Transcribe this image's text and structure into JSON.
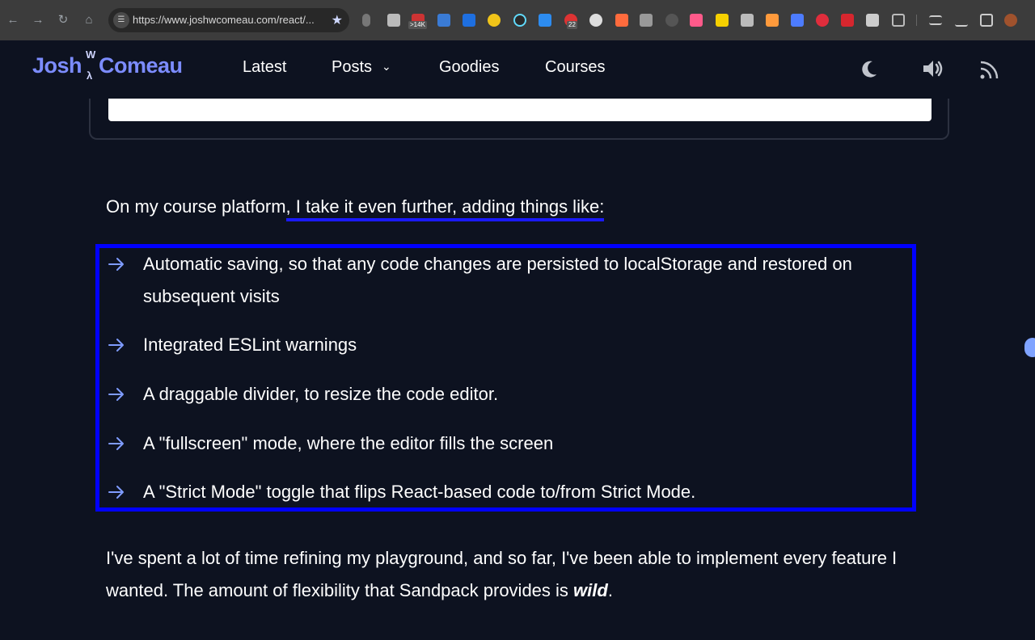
{
  "browser": {
    "url": "https://www.joshwcomeau.com/react/...",
    "ext_badges": [
      ">14K",
      "22"
    ]
  },
  "site": {
    "logo": {
      "first": "Josh",
      "middle_w": "W",
      "last": "Comeau"
    },
    "nav": [
      {
        "label": "Latest"
      },
      {
        "label": "Posts"
      },
      {
        "label": "Goodies"
      },
      {
        "label": "Courses"
      }
    ],
    "icons": [
      "moon-icon",
      "sound-icon",
      "rss-icon"
    ]
  },
  "article": {
    "intro_before": "On my course platform",
    "intro_highlight": ", I take it even further, adding things like:",
    "list": [
      "Automatic saving, so that any code changes are persisted to localStorage and restored on subsequent visits",
      "Integrated ESLint warnings",
      "A draggable divider, to resize the code editor.",
      "A \"fullscreen\" mode, where the editor fills the screen",
      "A \"Strict Mode\" toggle that flips React-based code to/from Strict Mode."
    ],
    "outro_before": "I've spent a lot of time refining my playground, and so far, I've been able to implement every feature I wanted. The amount of flexibility that Sandpack provides is ",
    "outro_emphasis": "wild",
    "outro_after": "."
  },
  "colors": {
    "background": "#0d1220",
    "brand": "#7c8cff",
    "annotation": "#0000ff",
    "arrow": "#7f9cff"
  }
}
